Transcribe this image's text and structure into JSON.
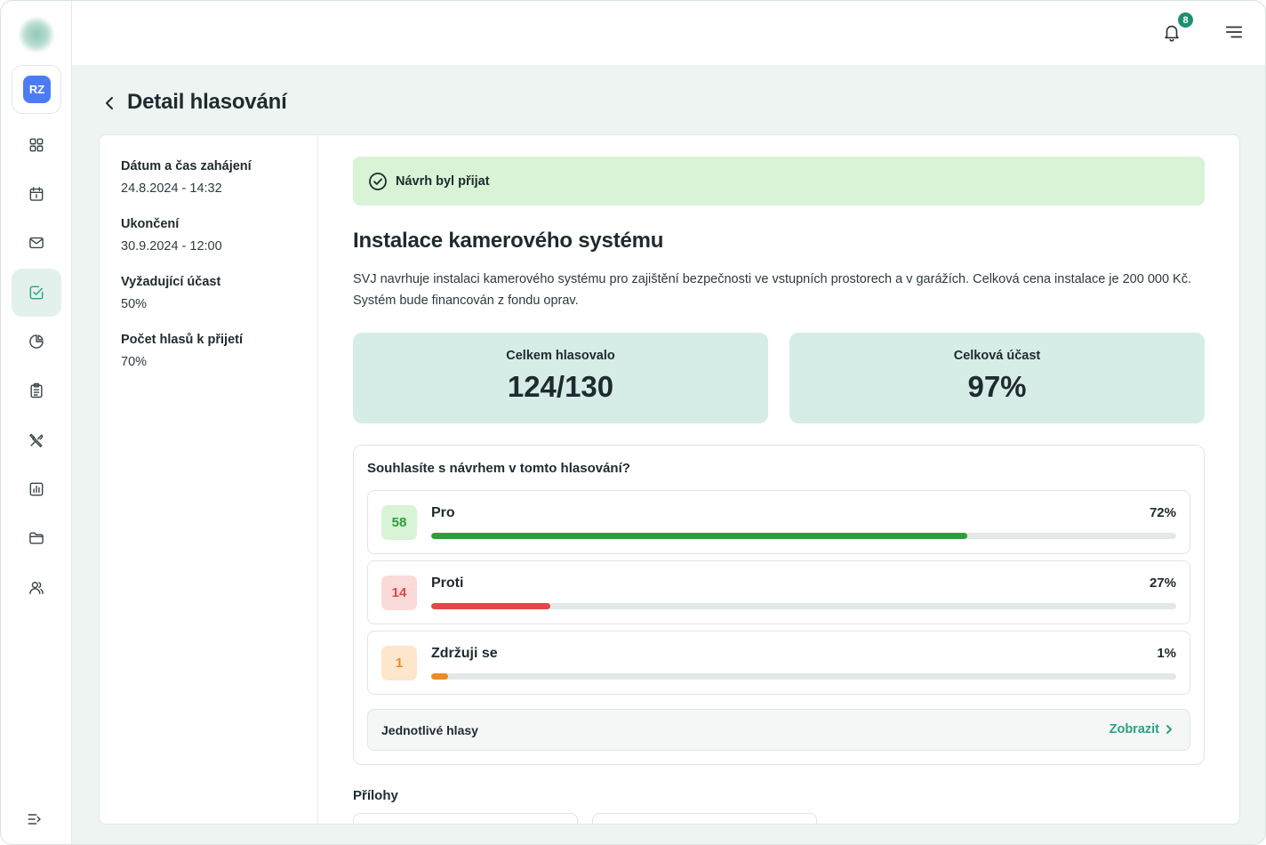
{
  "app": {
    "user_initials": "RZ",
    "notification_count": "8",
    "accent_color": "#2aa186",
    "nav_icons": [
      "dashboard-icon",
      "calendar-icon",
      "mail-icon",
      "check-square-icon",
      "pie-chart-icon",
      "clipboard-icon",
      "tools-icon",
      "bar-chart-icon",
      "folder-icon",
      "users-icon"
    ],
    "active_nav": "check-square-icon"
  },
  "page": {
    "title": "Detail hlasování"
  },
  "meta": [
    {
      "label": "Dátum a čas zahájení",
      "value": "24.8.2024 - 14:32"
    },
    {
      "label": "Ukončení",
      "value": "30.9.2024 - 12:00"
    },
    {
      "label": "Vyžadující účast",
      "value": "50%"
    },
    {
      "label": "Počet hlasů k přijetí",
      "value": "70%"
    }
  ],
  "status": {
    "text": "Návrh byl přijat",
    "color": "#d8f3d5"
  },
  "proposal": {
    "title": "Instalace kamerového systému",
    "description": "SVJ navrhuje instalaci kamerového systému pro zajištění bezpečnosti ve vstupních prostorech a v garážích. Celková cena instalace je 200 000 Kč. Systém bude financován z fondu oprav."
  },
  "stats": [
    {
      "label": "Celkem hlasovalo",
      "value": "124/130"
    },
    {
      "label": "Celková účast",
      "value": "97%"
    }
  ],
  "voting": {
    "question": "Souhlasíte s návrhem v tomto hlasování?",
    "options": [
      {
        "count": "58",
        "label": "Pro",
        "percent_text": "72%",
        "percent": 72,
        "color": "#2e9e3a",
        "badge_bg": "#d8f3d5",
        "badge_fg": "#2e9e3a"
      },
      {
        "count": "14",
        "label": "Proti",
        "percent_text": "27%",
        "percent": 16,
        "color": "#e64545",
        "badge_bg": "#fbdada",
        "badge_fg": "#e64545"
      },
      {
        "count": "1",
        "label": "Zdržuji se",
        "percent_text": "1%",
        "percent": 2.3,
        "color": "#ef8a22",
        "badge_bg": "#fde6cc",
        "badge_fg": "#ef8a22"
      }
    ],
    "individual_votes_label": "Jednotlivé hlasy",
    "show_label": "Zobrazit"
  },
  "attachments": {
    "title": "Přílohy"
  }
}
